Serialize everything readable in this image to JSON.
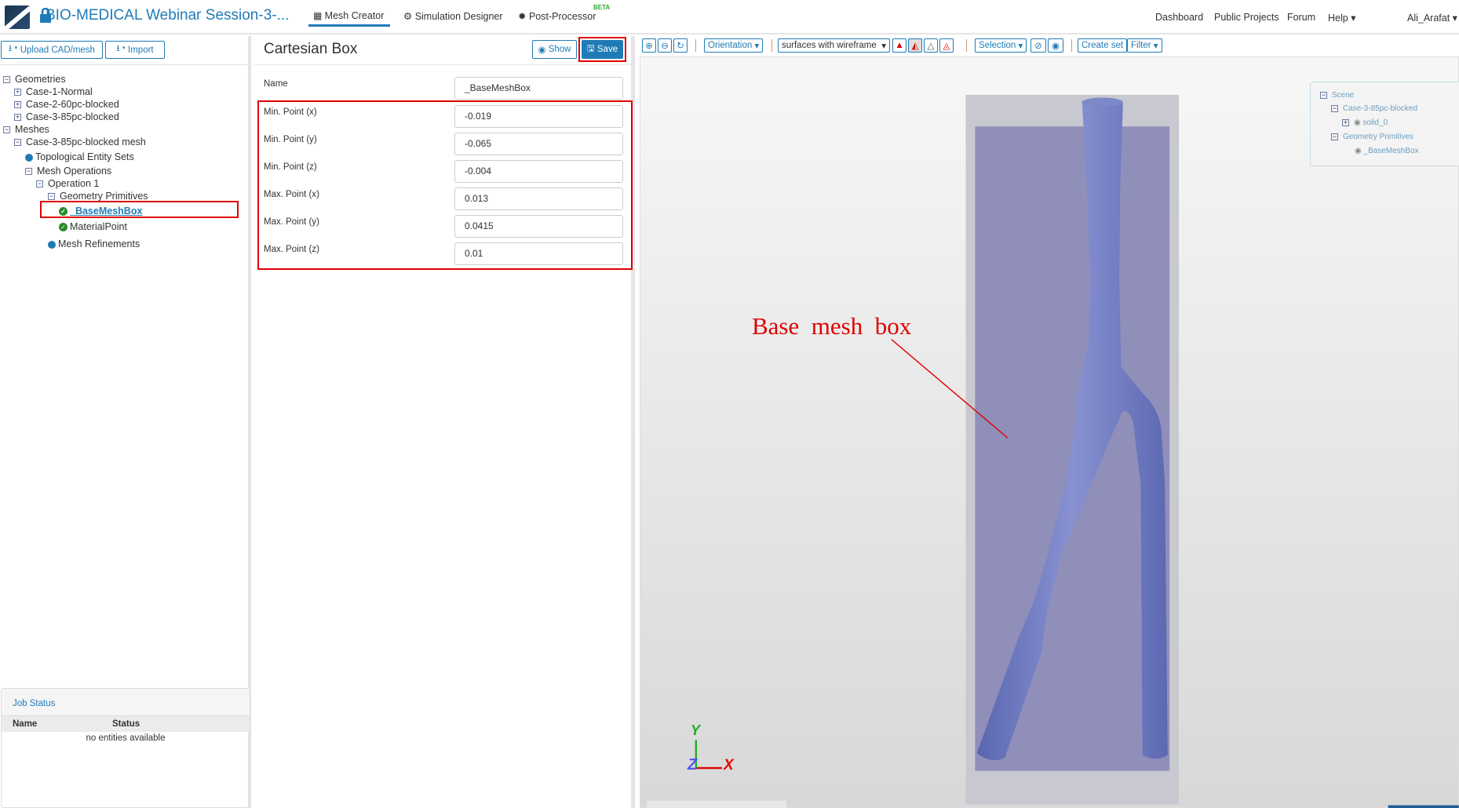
{
  "header": {
    "title": "BIO-MEDICAL Webinar Session-3-...",
    "tabs": [
      {
        "label": "Mesh Creator"
      },
      {
        "label": "Simulation Designer"
      },
      {
        "label": "Post-Processor"
      }
    ],
    "beta": "BETA",
    "links": [
      "Dashboard",
      "Public Projects",
      "Forum",
      "Help"
    ],
    "user": "Ali_Arafat"
  },
  "left": {
    "upload": "Upload CAD/mesh",
    "import": "Import",
    "tree": {
      "geometries": "Geometries",
      "g1": "Case-1-Normal",
      "g2": "Case-2-60pc-blocked",
      "g3": "Case-3-85pc-blocked",
      "meshes": "Meshes",
      "mesh": "Case-3-85pc-blocked mesh",
      "tes": "Topological Entity Sets",
      "mo": "Mesh Operations",
      "op1": "Operation 1",
      "gp": "Geometry Primitives",
      "bmb": "_BaseMeshBox",
      "mp": "MaterialPoint",
      "mr": "Mesh Refinements"
    },
    "job": {
      "title": "Job Status",
      "col_name": "Name",
      "col_status": "Status",
      "empty": "no entities available"
    }
  },
  "form": {
    "title": "Cartesian Box",
    "show": "Show",
    "save": "Save",
    "fields": [
      {
        "label": "Name",
        "value": "_BaseMeshBox"
      },
      {
        "label": "Min. Point (x)",
        "value": "-0.019"
      },
      {
        "label": "Min. Point (y)",
        "value": "-0.065"
      },
      {
        "label": "Min. Point (z)",
        "value": "-0.004"
      },
      {
        "label": "Max. Point (x)",
        "value": "0.013"
      },
      {
        "label": "Max. Point (y)",
        "value": "0.0415"
      },
      {
        "label": "Max. Point (z)",
        "value": "0.01"
      }
    ]
  },
  "viewer": {
    "orientation": "Orientation",
    "render_mode": "surfaces with wireframe",
    "selection": "Selection",
    "create_set": "Create set",
    "filter": "Filter",
    "scene": {
      "root": "Scene",
      "case": "Case-3-85pc-blocked",
      "solid": "solid_0",
      "gp": "Geometry Primitives",
      "box": "_BaseMeshBox"
    },
    "annotation": "Base  mesh  box",
    "axes": {
      "x": "X",
      "y": "Y",
      "z": "Z"
    }
  },
  "colors": {
    "accent": "#1f7bb6",
    "highlight": "#e00000",
    "vessel": "#7480c4",
    "box": "#8e8fb8"
  }
}
